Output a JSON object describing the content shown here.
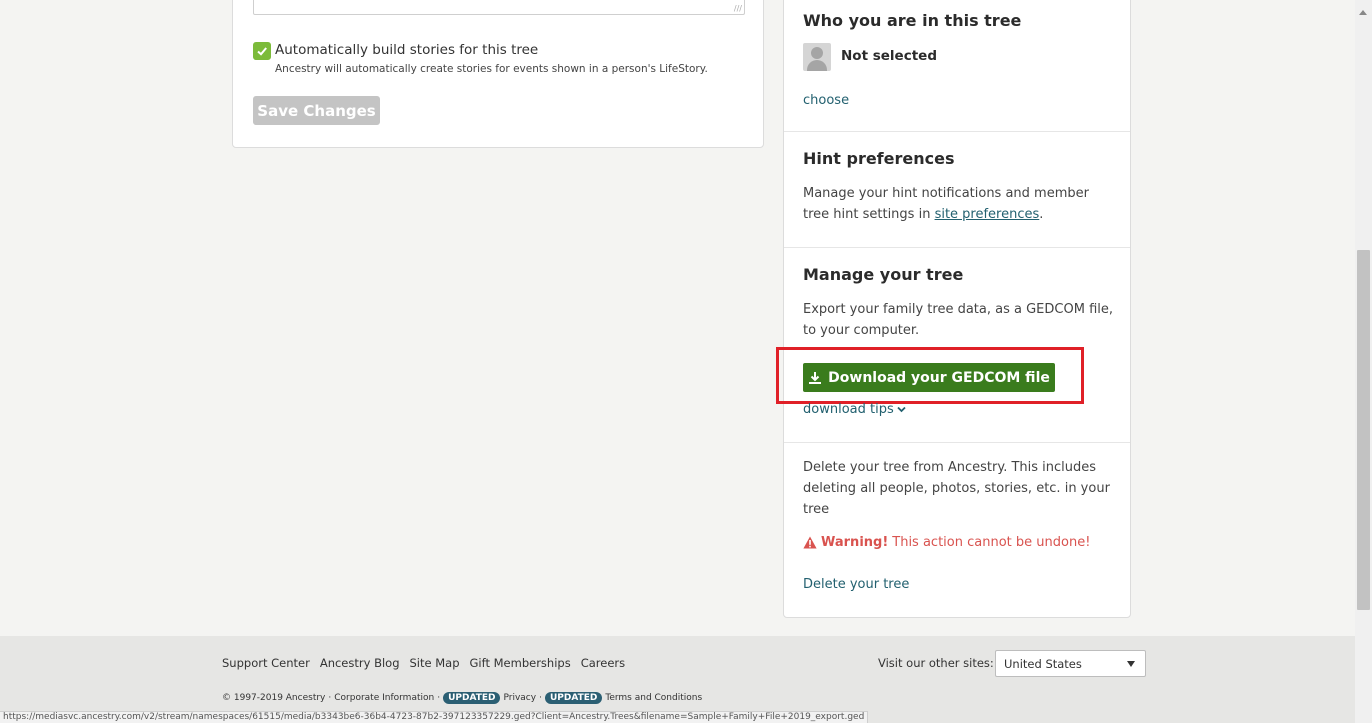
{
  "left_panel": {
    "auto_stories_label": "Automatically build stories for this tree",
    "auto_stories_help": "Ancestry will automatically create stories for events shown in a person's LifeStory.",
    "auto_stories_checked": true,
    "save_button": "Save Changes"
  },
  "right_panel": {
    "who": {
      "title": "Who you are in this tree",
      "status": "Not selected",
      "choose_link": "choose"
    },
    "hints": {
      "title": "Hint preferences",
      "text_before": "Manage your hint notifications and member tree hint settings in ",
      "link": "site preferences",
      "text_after": "."
    },
    "manage": {
      "title": "Manage your tree",
      "text": "Export your family tree data, as a GEDCOM file, to your computer.",
      "download_button": "Download your GEDCOM file",
      "tips_link": "download tips"
    },
    "delete": {
      "text": "Delete your tree from Ancestry. This includes deleting all people, photos, stories, etc. in your tree",
      "warning_bold": "Warning!",
      "warning_text": " This action cannot be undone!",
      "delete_link": "Delete your tree"
    }
  },
  "footer": {
    "links": [
      "Support Center",
      "Ancestry Blog",
      "Site Map",
      "Gift Memberships",
      "Careers"
    ],
    "visit_label": "Visit our other sites:",
    "site_select": "United States",
    "legal": {
      "copyright": "© 1997-2019 Ancestry",
      "corporate": "Corporate Information",
      "badge": "UPDATED",
      "privacy": "Privacy",
      "terms": "Terms and Conditions"
    }
  },
  "status_url": "https://mediasvc.ancestry.com/v2/stream/namespaces/61515/media/b3343be6-36b4-4723-87b2-397123357229.ged?Client=Ancestry.Trees&filename=Sample+Family+File+2019_export.ged",
  "colors": {
    "accent_green": "#3a7c1d",
    "checkbox_green": "#7cbb3a",
    "link": "#22606f",
    "warning": "#d9534f",
    "highlight": "#e02028"
  }
}
